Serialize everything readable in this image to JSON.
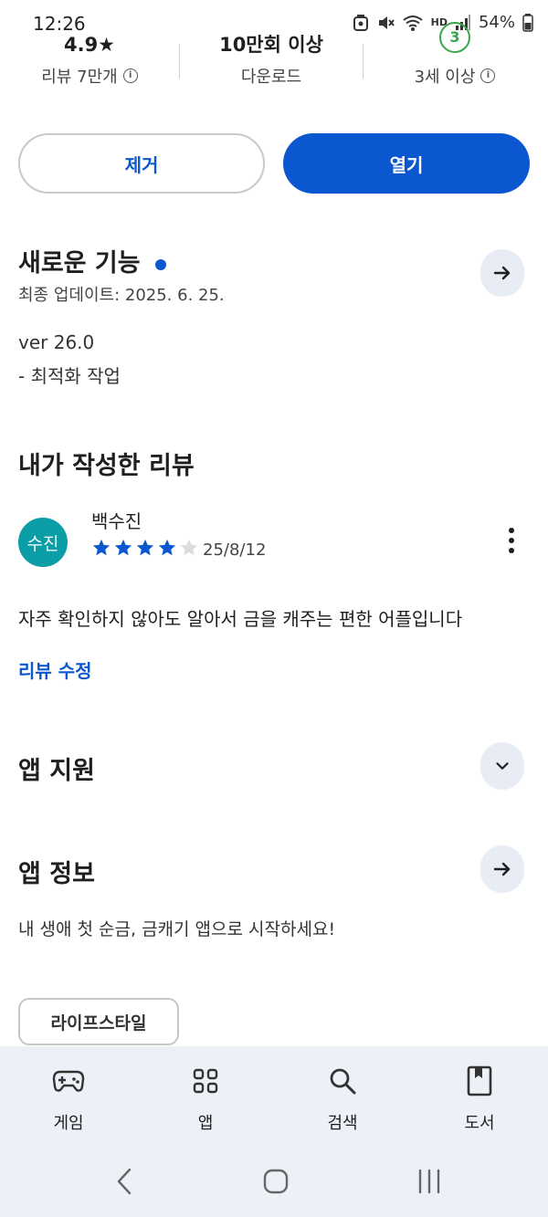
{
  "status_bar": {
    "time": "12:26",
    "battery": "54%",
    "hd_label": "HD"
  },
  "stats": {
    "rating": {
      "value": "4.9★",
      "label": "리뷰 7만개"
    },
    "downloads": {
      "value": "10만회 이상",
      "label": "다운로드"
    },
    "age": {
      "value": "3",
      "label": "3세 이상"
    }
  },
  "actions": {
    "remove_label": "제거",
    "open_label": "열기"
  },
  "whats_new": {
    "title": "새로운 기능",
    "updated": "최종 업데이트: 2025. 6. 25.",
    "version": "ver 26.0",
    "notes": "- 최적화 작업"
  },
  "my_review": {
    "title": "내가 작성한 리뷰",
    "avatar_text": "수진",
    "author": "백수진",
    "rating": 4,
    "date": "25/8/12",
    "text": "자주 확인하지 않아도 알아서 금을 캐주는 편한 어플입니다",
    "edit_label": "리뷰 수정"
  },
  "app_support": {
    "title": "앱 지원"
  },
  "app_info": {
    "title": "앱 정보",
    "description": "내 생애 첫 순금, 금캐기 앱으로 시작하세요!",
    "category_chip": "라이프스타일"
  },
  "bottom_nav": [
    {
      "label": "게임",
      "icon": "gamepad-icon"
    },
    {
      "label": "앱",
      "icon": "apps-grid-icon"
    },
    {
      "label": "검색",
      "icon": "search-icon"
    },
    {
      "label": "도서",
      "icon": "book-icon"
    }
  ],
  "colors": {
    "accent": "#0b57d0",
    "avatar": "#0b9ea6",
    "age_badge": "#3aa54a",
    "nav_bg": "#eef0f8"
  }
}
